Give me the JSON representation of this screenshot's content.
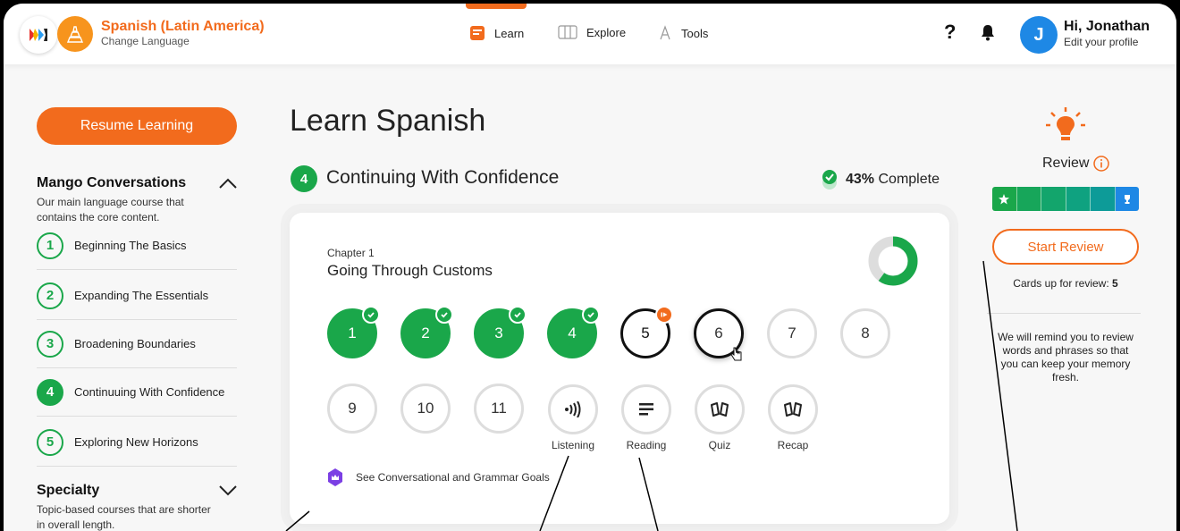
{
  "header": {
    "language_name": "Spanish (Latin America)",
    "change_language": "Change Language",
    "nav": {
      "learn": "Learn",
      "explore": "Explore",
      "tools": "Tools"
    },
    "help": "?",
    "avatar_initial": "J",
    "greeting": "Hi, Jonathan",
    "edit_profile": "Edit your profile",
    "accent_color": "#f26b1d"
  },
  "sidebar": {
    "resume_label": "Resume Learning",
    "conversations": {
      "title": "Mango Conversations",
      "description": "Our main language course that contains the core content.",
      "items": [
        {
          "number": "1",
          "label": "Beginning The Basics"
        },
        {
          "number": "2",
          "label": "Expanding The Essentials"
        },
        {
          "number": "3",
          "label": "Broadening Boundaries"
        },
        {
          "number": "4",
          "label": "Continuuing With Confidence"
        },
        {
          "number": "5",
          "label": "Exploring New Horizons"
        }
      ]
    },
    "specialty": {
      "title": "Specialty",
      "description": "Topic-based courses that are shorter in overall length."
    }
  },
  "main": {
    "page_title": "Learn Spanish",
    "unit_number": "4",
    "unit_title": "Continuing With Confidence",
    "complete_percent": "43%",
    "complete_label": "Complete",
    "chapter": {
      "label": "Chapter 1",
      "title": "Going Through Customs",
      "progress_fraction": 0.6,
      "lessons": [
        {
          "label": "1",
          "state": "done"
        },
        {
          "label": "2",
          "state": "done"
        },
        {
          "label": "3",
          "state": "done"
        },
        {
          "label": "4",
          "state": "done"
        },
        {
          "label": "5",
          "state": "current"
        },
        {
          "label": "6",
          "state": "hover"
        },
        {
          "label": "7",
          "state": "todo"
        },
        {
          "label": "8",
          "state": "todo"
        },
        {
          "label": "9",
          "state": "todo"
        },
        {
          "label": "10",
          "state": "todo"
        },
        {
          "label": "11",
          "state": "todo"
        }
      ],
      "activities": {
        "listening": "Listening",
        "reading": "Reading",
        "quiz": "Quiz",
        "recap": "Recap"
      },
      "goals_link": "See Conversational and Grammar Goals"
    }
  },
  "review": {
    "title": "Review",
    "start_label": "Start Review",
    "cards_label": "Cards up for review:",
    "cards_count": "5",
    "remind_text": "We will remind you to review words and phrases so that you can keep your memory fresh."
  }
}
